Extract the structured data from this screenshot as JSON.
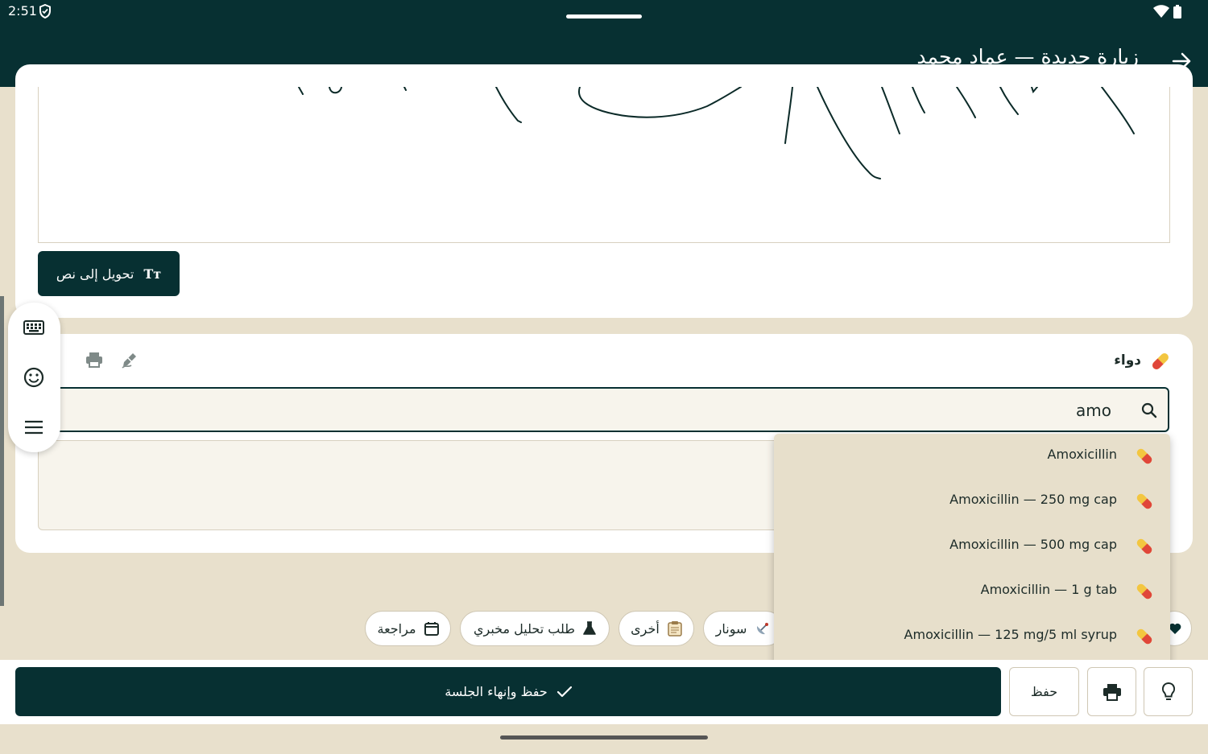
{
  "status": {
    "time": "2:51"
  },
  "appbar": {
    "title": "زيارة جديدة — عماد محمد"
  },
  "drawing": {
    "convert_label": "تحويل إلى نص",
    "convert_icon": "Tт"
  },
  "medication": {
    "title": "دواء",
    "search_value": "amo",
    "suggestions": [
      {
        "label": "Amoxicillin"
      },
      {
        "label": "Amoxicillin — 250 mg cap"
      },
      {
        "label": "Amoxicillin — 500 mg cap"
      },
      {
        "label": "Amoxicillin — 1 g tab"
      },
      {
        "label": "Amoxicillin — 125 mg/5 ml syrup"
      }
    ]
  },
  "chips": {
    "followup": "مراجعة",
    "lab": "طلب تحليل مخبري",
    "other": "أخرى",
    "sonar": "سونار"
  },
  "actions": {
    "save_finish": "حفظ وإنهاء الجلسة",
    "save": "حفظ"
  },
  "colors": {
    "primary": "#073032",
    "background": "#e8e0cc",
    "dropdown": "#e7dfcb"
  }
}
